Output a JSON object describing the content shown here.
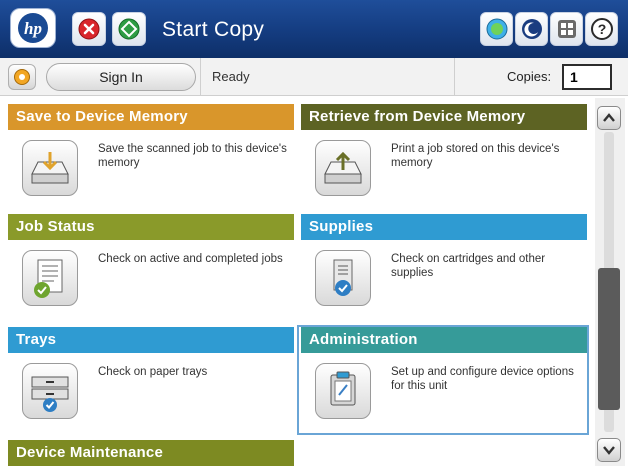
{
  "header": {
    "logo_icon": "hp-logo",
    "stop_icon": "stop-icon",
    "start_icon": "start-copy-icon",
    "title": "Start Copy",
    "network_icon": "network-icon",
    "sleep_icon": "sleep-icon",
    "language_icon": "language-icon",
    "help_icon": "help-icon"
  },
  "statusbar": {
    "home_icon": "home-icon",
    "sign_in_label": "Sign In",
    "status": "Ready",
    "copies_label": "Copies:",
    "copies_value": "1"
  },
  "tiles": [
    {
      "header": "Save to Device Memory",
      "description": "Save the scanned job to this device's memory",
      "icon": "save-to-memory-icon",
      "color": "#d9962b"
    },
    {
      "header": "Retrieve from Device Memory",
      "description": "Print a job stored on this device's memory",
      "icon": "retrieve-from-memory-icon",
      "color": "#5d6323"
    },
    {
      "header": "Job Status",
      "description": "Check on active and completed jobs",
      "icon": "job-status-icon",
      "color": "#8a9a2a"
    },
    {
      "header": "Supplies",
      "description": "Check on cartridges and other supplies",
      "icon": "supplies-icon",
      "color": "#2f9bd2"
    },
    {
      "header": "Trays",
      "description": "Check on paper trays",
      "icon": "trays-icon",
      "color": "#2f9bd2"
    },
    {
      "header": "Administration",
      "description": "Set up and configure device options for this unit",
      "icon": "administration-icon",
      "color": "#369b99"
    },
    {
      "header": "Device Maintenance",
      "description": "",
      "icon": "",
      "color": "#7d8a22"
    }
  ],
  "scrollbar": {
    "up_icon": "chevron-up-icon",
    "down_icon": "chevron-down-icon"
  }
}
